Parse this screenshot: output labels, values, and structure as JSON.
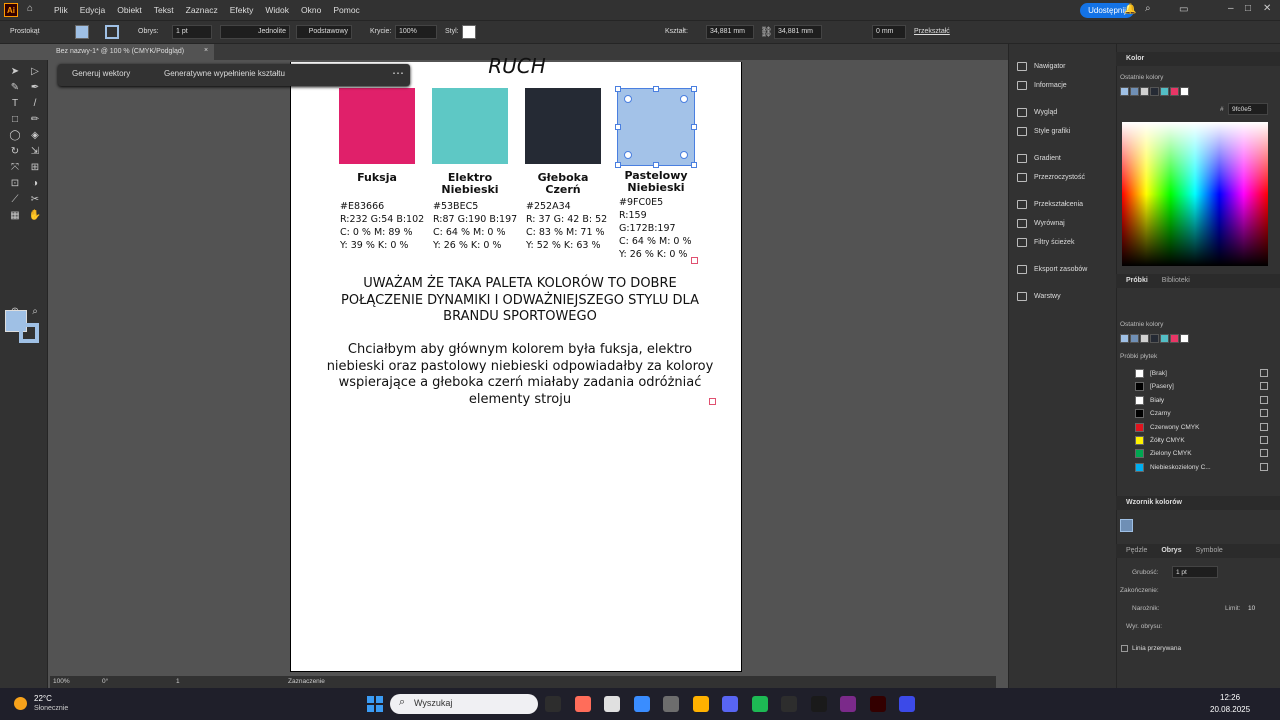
{
  "menu": {
    "items": [
      "Plik",
      "Edycja",
      "Obiekt",
      "Tekst",
      "Zaznacz",
      "Efekty",
      "Widok",
      "Okno",
      "Pomoc"
    ],
    "share": "Udostępnij",
    "app_badge": "Ai"
  },
  "control": {
    "tool_name": "Prostokąt",
    "stroke_label": "Obrys:",
    "stroke_value": "1 pt",
    "stroke_style": "Jednolite",
    "brush": "Podstawowy",
    "opacity_label": "Krycie:",
    "opacity_value": "100%",
    "style_label": "Styl:",
    "shape_label": "Kształt:",
    "width": "34,881 mm",
    "height": "34,881 mm",
    "radius": "0 mm",
    "transform_label": "Przekształć"
  },
  "tab": {
    "title": "Bez nazwy-1* @ 100 % (CMYK/Podgląd)",
    "close": "×"
  },
  "context": {
    "gen_vectors": "Generuj wektory",
    "gen_fill": "Generatywne wypełnienie kształtu",
    "more": "⋯"
  },
  "artboard": {
    "top_title": "RUCH",
    "colors": [
      {
        "name": "Fuksja",
        "hex": "#E83666",
        "info": "#E83666\nR:232 G:54 B:102\nC: 0 % M: 89 %\nY: 39 % K: 0 %",
        "fill": "#e0206a"
      },
      {
        "name": "Elektro\nNiebieski",
        "hex": "#53BEC5",
        "info": "#53BEC5\nR:87 G:190 B:197\nC: 64 % M: 0 %\nY: 26 % K: 0 %",
        "fill": "#5ec8c5"
      },
      {
        "name": "Głeboka\nCzerń",
        "hex": "#252A34",
        "info": "#252A34\nR: 37 G: 42 B: 52\nC: 83 % M: 71 %\nY: 52 % K: 63 %",
        "fill": "#252a34"
      },
      {
        "name": "Pastelowy\nNiebieski",
        "hex": "#9FC0E5",
        "info": "#9FC0E5\nR:159\nG:172B:197\nC: 64 % M: 0 %\nY: 26 % K: 0 %",
        "fill": "#a3c2e8"
      }
    ],
    "statement": "UWAŻAM ŻE TAKA PALETA KOLORÓW TO DOBRE POŁĄCZENIE DYNAMIKI I ODWAŻNIEJSZEGO STYLU DLA BRANDU SPORTOWEGO",
    "description": "Chciałbym aby głównym kolorem była fuksja, elektro niebieski oraz pastolowy niebieski odpowiadałby za koloroy wspierające a głeboka czerń miałaby zadania odróżniać elementy stroju"
  },
  "midpanel": {
    "items": [
      "Nawigator",
      "Informacje",
      "Wygląd",
      "Style grafiki",
      "Gradient",
      "Przezroczystość",
      "Przekształcenia",
      "Wyrównaj",
      "Filtry ścieżek",
      "Eksport zasobów",
      "Warstwy"
    ]
  },
  "color_panel": {
    "title": "Kolor",
    "recent_label": "Ostatnie kolory",
    "hex_label": "#",
    "hex_value": "9fc0e5"
  },
  "swatches_panel": {
    "tabs": [
      "Próbki",
      "Biblioteki"
    ],
    "recent_label": "Ostatnie kolory",
    "group_label": "Próbki płytek",
    "items": [
      {
        "name": "[Brak]",
        "color": "#ffffff"
      },
      {
        "name": "[Pasery]",
        "color": "#000000"
      },
      {
        "name": "Biały",
        "color": "#ffffff"
      },
      {
        "name": "Czarny",
        "color": "#000000"
      },
      {
        "name": "Czerwony CMYK",
        "color": "#e0141e"
      },
      {
        "name": "Żółty CMYK",
        "color": "#fff200"
      },
      {
        "name": "Zielony CMYK",
        "color": "#00a651"
      },
      {
        "name": "Niebieskozielony C...",
        "color": "#00aeef"
      }
    ]
  },
  "brush_panel": {
    "title": "Wzornik kolorów"
  },
  "stroke_panel": {
    "tabs": [
      "Pędzle",
      "Obrys",
      "Symbole"
    ],
    "weight_label": "Grubość:",
    "weight_value": "1 pt",
    "cap_label": "Zakończenie:",
    "corner_label": "Narożnik:",
    "limit_label": "Limit:",
    "limit_value": "10",
    "align_label": "Wyr. obrysu:",
    "dashed_label": "Linia przerywana"
  },
  "status": {
    "zoom": "100%",
    "rotate": "0°",
    "artboard": "1",
    "mode": "Zaznaczenie"
  },
  "taskbar": {
    "weather_temp": "22°C",
    "weather_desc": "Słonecznie",
    "search": "Wyszukaj",
    "time": "12:26",
    "date": "20.08.2025"
  }
}
